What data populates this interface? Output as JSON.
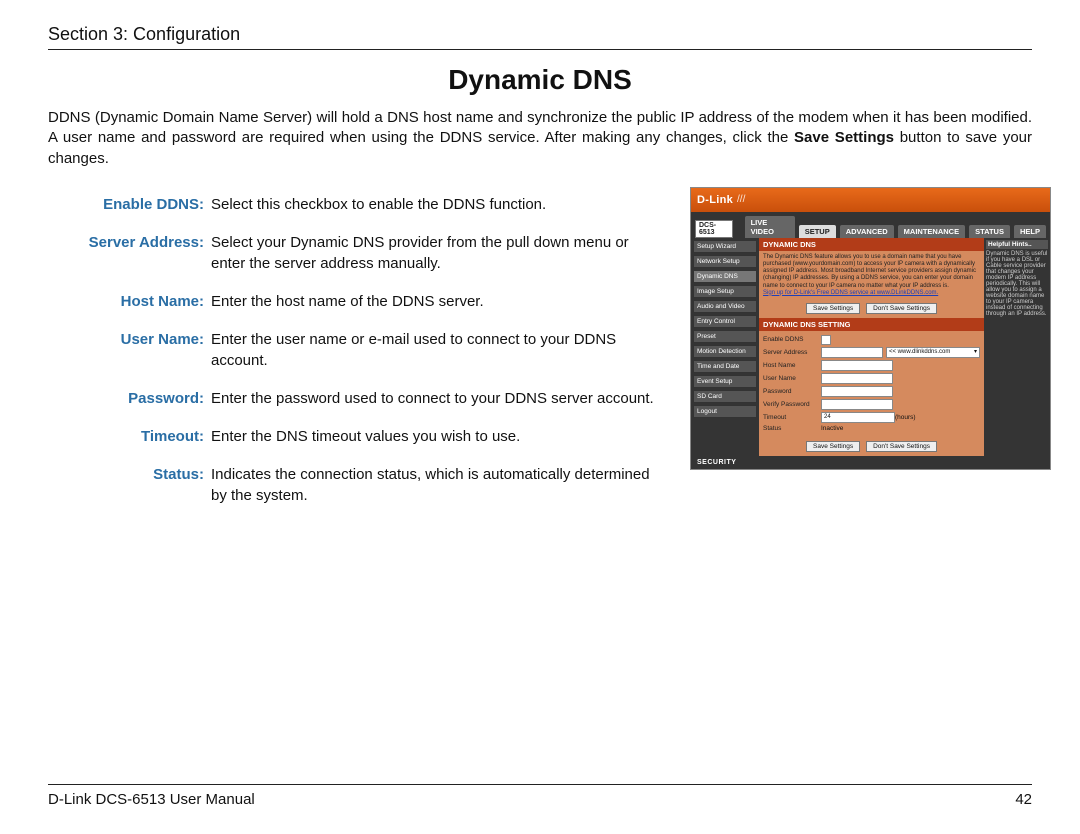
{
  "header": {
    "section": "Section 3: Configuration"
  },
  "title": "Dynamic DNS",
  "intro": {
    "pre": "DDNS (Dynamic Domain Name Server) will hold a DNS host name and synchronize the public IP address of the modem when it has been modified. A user name and password are required when using the DDNS service. After making any changes, click the ",
    "bold": "Save Settings",
    "post": " button to save your changes."
  },
  "defs": [
    {
      "label": "Enable DDNS:",
      "desc": "Select this checkbox to enable the DDNS function."
    },
    {
      "label": "Server Address:",
      "desc": "Select your Dynamic DNS provider from the pull down menu or enter the server address manually."
    },
    {
      "label": "Host Name:",
      "desc": "Enter the host name of the DDNS server."
    },
    {
      "label": "User Name:",
      "desc": "Enter the user name or e-mail used to connect to your DDNS account."
    },
    {
      "label": "Password:",
      "desc": "Enter the password used to connect to your DDNS server account."
    },
    {
      "label": "Timeout:",
      "desc": "Enter the DNS timeout values you wish to use."
    },
    {
      "label": "Status:",
      "desc": "Indicates the connection status, which is automatically determined by the system."
    }
  ],
  "screenshot": {
    "brand": "D-Link",
    "model": "DCS-6513",
    "tabs": [
      "LIVE VIDEO",
      "SETUP",
      "ADVANCED",
      "MAINTENANCE",
      "STATUS",
      "HELP"
    ],
    "tabs_active_index": 1,
    "sidenav": [
      "Setup Wizard",
      "Network Setup",
      "Dynamic DNS",
      "Image Setup",
      "Audio and Video",
      "Entry Control",
      "Preset",
      "Motion Detection",
      "Time and Date",
      "Event Setup",
      "SD Card",
      "Logout"
    ],
    "sidenav_active_index": 2,
    "panel_title_1": "DYNAMIC DNS",
    "panel_intro": "The Dynamic DNS feature allows you to use a domain name that you have purchased (www.yourdomain.com) to access your IP camera with a dynamically assigned IP address. Most broadband Internet service providers assign dynamic (changing) IP addresses. By using a DDNS service, you can enter your domain name to connect to your IP camera no matter what your IP address is.",
    "panel_link": "Sign up for D-Link's Free DDNS service at www.DLinkDDNS.com.",
    "btn_save": "Save Settings",
    "btn_dont": "Don't Save Settings",
    "panel_title_2": "DYNAMIC DNS SETTING",
    "form": [
      {
        "label": "Enable DDNS",
        "type": "check"
      },
      {
        "label": "Server Address",
        "type": "inputselect",
        "select_text": "<< www.dlinkddns.com"
      },
      {
        "label": "Host Name",
        "type": "input"
      },
      {
        "label": "User Name",
        "type": "input"
      },
      {
        "label": "Password",
        "type": "input"
      },
      {
        "label": "Verify Password",
        "type": "input"
      },
      {
        "label": "Timeout",
        "type": "input",
        "suffix": "(hours)",
        "value": "24"
      },
      {
        "label": "Status",
        "type": "text",
        "text": "Inactive"
      }
    ],
    "help_title": "Helpful Hints..",
    "help_text": "Dynamic DNS is useful if you have a DSL or Cable service provider that changes your modem IP address periodically. This will allow you to assign a website domain name to your IP camera instead of connecting through an IP address.",
    "security": "SECURITY"
  },
  "footer": {
    "left": "D-Link DCS-6513 User Manual",
    "right": "42"
  }
}
